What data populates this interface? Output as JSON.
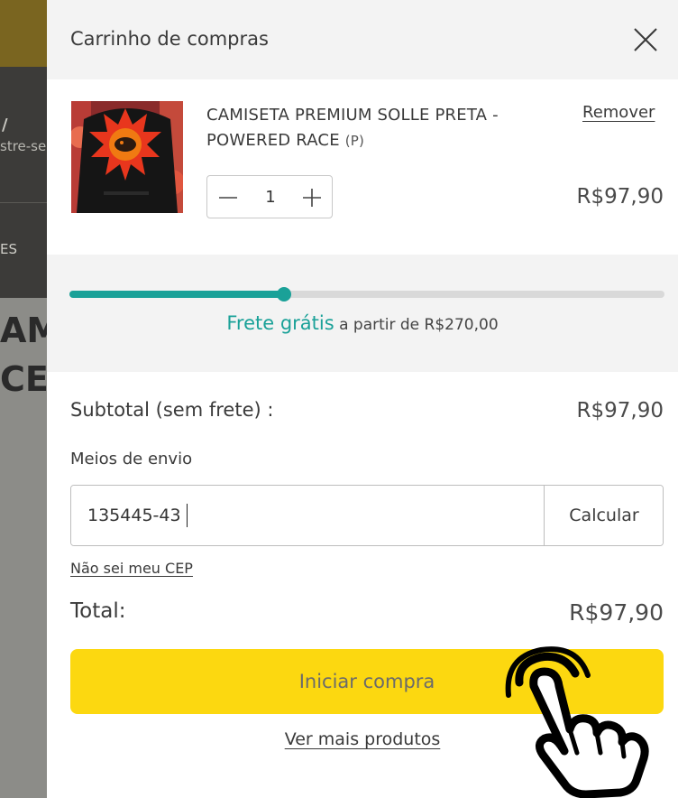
{
  "background": {
    "slash": "/",
    "partial_link": "stre-se",
    "partial_nav": "ES",
    "partial_heading_1": "AM",
    "partial_heading_2": "CE"
  },
  "cart": {
    "title": "Carrinho de compras",
    "close_icon": "close-icon",
    "item": {
      "name": "CAMISETA PREMIUM SOLLE PRETA - POWERED RACE",
      "size": "(P)",
      "remove_label": "Remover",
      "quantity": "1",
      "price": "R$97,90",
      "image_icon": "product-thumbnail"
    },
    "shipping_progress": {
      "free_label": "Frete grátis",
      "threshold_text": "a partir de R$270,00",
      "progress_fraction": 0.36
    },
    "subtotal_label": "Subtotal (sem frete) :",
    "subtotal_value": "R$97,90",
    "shipping_label": "Meios de envio",
    "cep_value": "135445-43",
    "calculate_label": "Calcular",
    "unknown_cep_link": "Não sei meu CEP",
    "total_label": "Total:",
    "total_value": "R$97,90",
    "checkout_label": "Iniciar compra",
    "more_products_link": "Ver mais produtos"
  },
  "colors": {
    "accent": "#1aa198",
    "checkout_button": "#fcd810",
    "header_bg": "#f3f3f3"
  }
}
